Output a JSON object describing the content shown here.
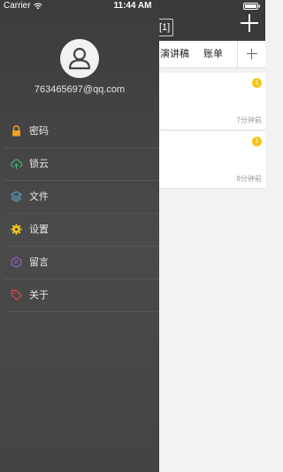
{
  "status_bar": {
    "carrier": "Carrier",
    "time": "11:44 AM"
  },
  "background_app": {
    "title_box": "[1]",
    "tabs": [
      "演讲稿",
      "账单"
    ],
    "cards": [
      {
        "badge": "1",
        "time": "7分钟前"
      },
      {
        "badge": "1",
        "time": "8分钟前"
      }
    ]
  },
  "drawer": {
    "email": "763465697@qq.com",
    "menu": [
      {
        "label": "密码",
        "icon": "lock-icon",
        "color": "#f0a020"
      },
      {
        "label": "锁云",
        "icon": "cloud-upload-icon",
        "color": "#3cb878"
      },
      {
        "label": "文件",
        "icon": "layers-icon",
        "color": "#5aa0c8"
      },
      {
        "label": "设置",
        "icon": "gear-icon",
        "color": "#f5c518"
      },
      {
        "label": "留言",
        "icon": "message-icon",
        "color": "#9a5fc8"
      },
      {
        "label": "关于",
        "icon": "tag-icon",
        "color": "#e04848"
      }
    ]
  }
}
